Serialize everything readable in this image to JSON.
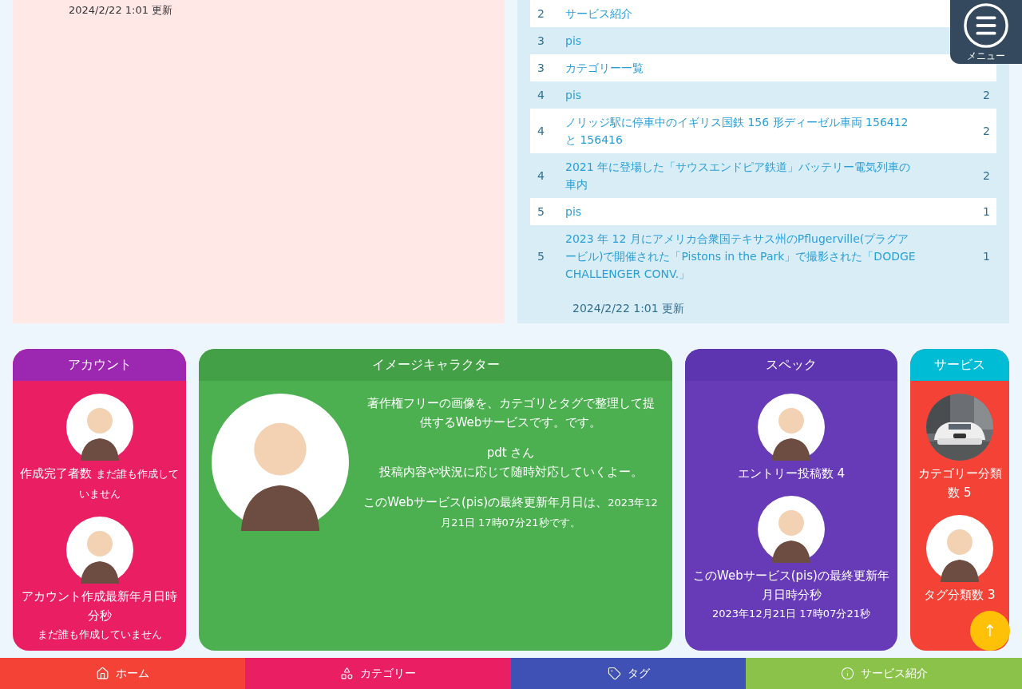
{
  "left_panel": {
    "updated": "2024/2/22 1:01 更新"
  },
  "ranking": {
    "rows": [
      {
        "rank": "2",
        "title": "サービス紹介"
      },
      {
        "rank": "3",
        "title": "pis"
      },
      {
        "rank": "3",
        "title": "カテゴリー一覧"
      },
      {
        "rank": "4",
        "title": "pis",
        "count": "2"
      },
      {
        "rank": "4",
        "title": "ノリッジ駅に停車中のイギリス国鉄 156 形ディーゼル車両 156412 と 156416",
        "count": "2"
      },
      {
        "rank": "4",
        "title": "2021 年に登場した「サウスエンドピア鉄道」バッテリー電気列車の車内",
        "count": "2"
      },
      {
        "rank": "5",
        "title": "pis",
        "count": "1"
      },
      {
        "rank": "5",
        "title": "2023 年 12 月にアメリカ合衆国テキサス州のPflugerville(プラグアービル)で開催された「Pistons in the Park」で撮影された「DODGE CHALLENGER CONV.」",
        "count": "1"
      }
    ],
    "updated": "2024/2/22 1:01 更新"
  },
  "menu_button": {
    "label": "メニュー"
  },
  "cards": [
    {
      "title": "アカウント",
      "color": "#e91e63",
      "items": [
        {
          "kind": "inline",
          "label": "作成完了者数",
          "value": "まだ誰も作成していません"
        },
        {
          "kind": "block",
          "label": "アカウント作成最新年月日時分秒",
          "value": "まだ誰も作成していません"
        }
      ]
    },
    {
      "title": "イメージキャラクター",
      "color": "#4caf50",
      "paragraphs": [
        {
          "text": "著作権フリーの画像を、カテゴリとタグで整理して提供するWebサービスです。です。"
        },
        {
          "text": "pdt さん",
          "note": "投稿内容や状況に応じて随時対応していくよー。"
        },
        {
          "text": "このWebサービス(pis)の最終更新年月日は、",
          "small": "2023年12月21日 17時07分21秒です。"
        }
      ]
    },
    {
      "title": "スペック",
      "color": "#673ab7",
      "items": [
        {
          "kind": "inline",
          "label": "エントリー投稿数",
          "value": "4"
        },
        {
          "kind": "block",
          "label": "このWebサービス(pis)の最終更新年月日時分秒",
          "value": "2023年12月21日 17時07分21秒"
        }
      ]
    },
    {
      "title": "サービス",
      "color": "#f44336",
      "items": [
        {
          "label": "カテゴリー分類数",
          "value": "5"
        },
        {
          "kind": "inline",
          "label": "タグ分類数",
          "value": "3"
        }
      ]
    }
  ],
  "scroll_top": {
    "label": "↑"
  },
  "nav": [
    {
      "label": "ホーム",
      "color": "#f44336"
    },
    {
      "label": "カテゴリー",
      "color": "#e91e63"
    },
    {
      "label": "タグ",
      "color": "#3f51b5"
    },
    {
      "label": "サービス紹介",
      "color": "#8bc34a"
    }
  ]
}
